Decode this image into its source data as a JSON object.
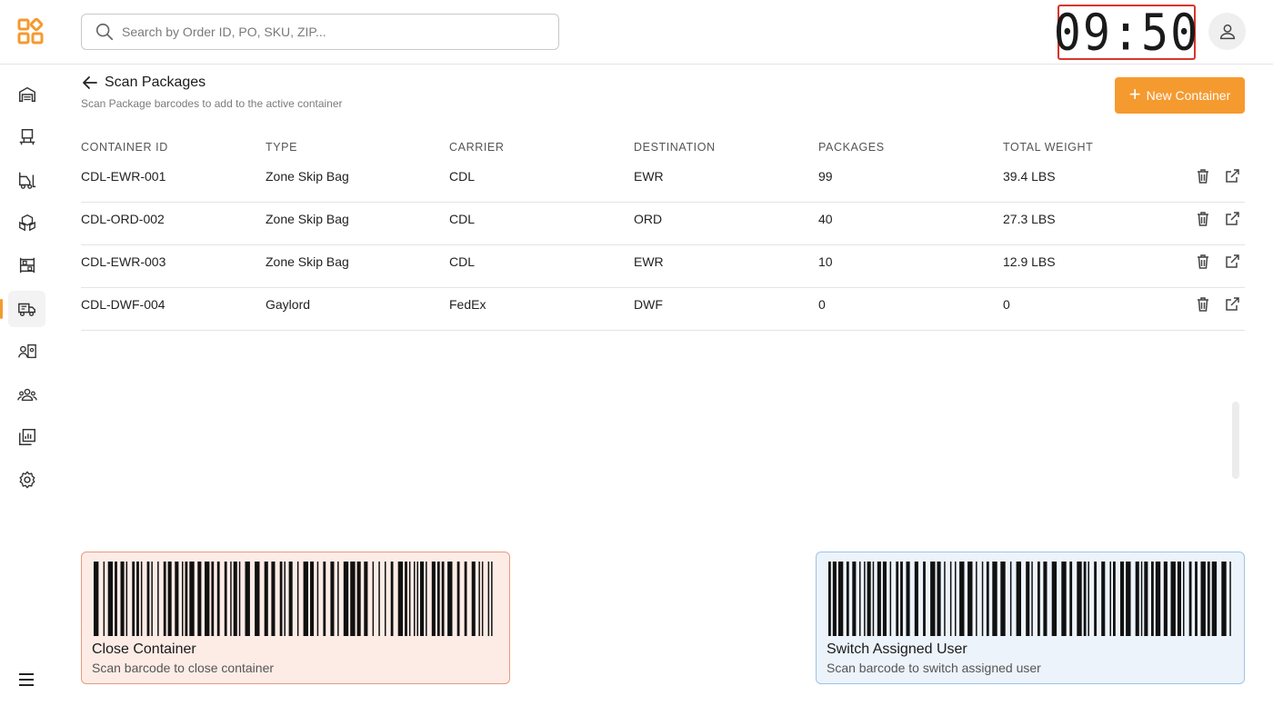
{
  "search": {
    "placeholder": "Search by Order ID, PO, SKU, ZIP..."
  },
  "clock": {
    "time": "09:50"
  },
  "colors": {
    "accent": "#f59a2f",
    "clock_border": "#d9342b"
  },
  "sidebar": {
    "items": [
      {
        "icon": "warehouse-icon",
        "active": false
      },
      {
        "icon": "workstation-icon",
        "active": false
      },
      {
        "icon": "forklift-icon",
        "active": false
      },
      {
        "icon": "boxes-icon",
        "active": false
      },
      {
        "icon": "shelves-icon",
        "active": false
      },
      {
        "icon": "truck-icon",
        "active": true
      },
      {
        "icon": "contact-card-icon",
        "active": false
      },
      {
        "icon": "team-icon",
        "active": false
      },
      {
        "icon": "reports-icon",
        "active": false
      },
      {
        "icon": "gear-icon",
        "active": false
      }
    ],
    "menu_icon": "hamburger-menu-icon"
  },
  "header": {
    "title": "Scan Packages",
    "subtitle": "Scan Package barcodes to add to the active container",
    "new_button": "New Container"
  },
  "table": {
    "columns": [
      "CONTAINER ID",
      "TYPE",
      "CARRIER",
      "DESTINATION",
      "PACKAGES",
      "TOTAL WEIGHT"
    ],
    "rows": [
      {
        "id": "CDL-EWR-001",
        "type": "Zone Skip Bag",
        "carrier": "CDL",
        "destination": "EWR",
        "packages": "99",
        "weight": "39.4 LBS"
      },
      {
        "id": "CDL-ORD-002",
        "type": "Zone Skip Bag",
        "carrier": "CDL",
        "destination": "ORD",
        "packages": "40",
        "weight": "27.3 LBS"
      },
      {
        "id": "CDL-EWR-003",
        "type": "Zone Skip Bag",
        "carrier": "CDL",
        "destination": "EWR",
        "packages": "10",
        "weight": "12.9 LBS"
      },
      {
        "id": "CDL-DWF-004",
        "type": "Gaylord",
        "carrier": "FedEx",
        "destination": "DWF",
        "packages": "0",
        "weight": "0"
      }
    ]
  },
  "cards": {
    "close": {
      "title": "Close Container",
      "subtitle": "Scan barcode to close container"
    },
    "switch": {
      "title": "Switch Assigned User",
      "subtitle": "Scan barcode to switch assigned user"
    }
  }
}
